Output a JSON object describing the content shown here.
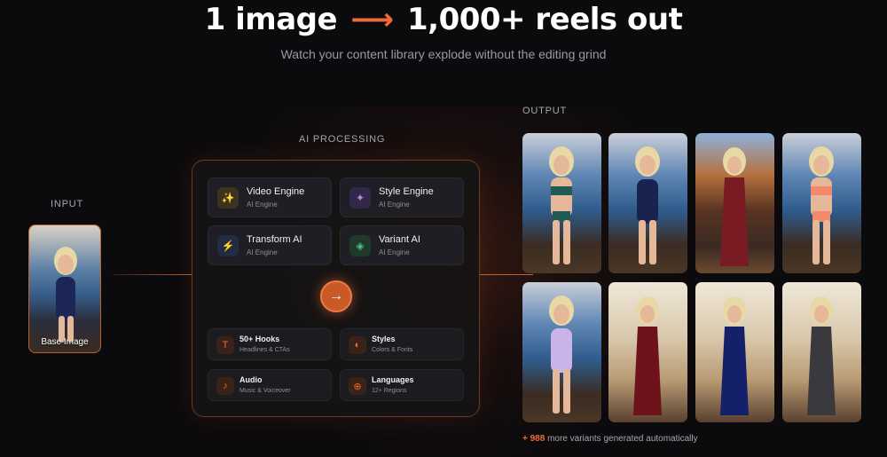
{
  "hero": {
    "title_left": "1 image",
    "arrow": "⟶",
    "title_right": "1,000+ reels out",
    "subtitle": "Watch your content library explode without the editing grind"
  },
  "input": {
    "label": "INPUT",
    "caption": "Base Image"
  },
  "processing": {
    "label": "AI PROCESSING",
    "engines": [
      {
        "name": "Video Engine",
        "sub": "AI Engine",
        "icon": "sparkles-icon",
        "glyph": "✨",
        "color": "#c9a23a"
      },
      {
        "name": "Style Engine",
        "sub": "AI Engine",
        "icon": "magic-wand-icon",
        "glyph": "✦",
        "color": "#b88ae8"
      },
      {
        "name": "Transform AI",
        "sub": "AI Engine",
        "icon": "lightning-icon",
        "glyph": "⚡",
        "color": "#5c8fe0"
      },
      {
        "name": "Variant AI",
        "sub": "AI Engine",
        "icon": "layers-icon",
        "glyph": "◈",
        "color": "#4fc07a"
      }
    ],
    "go_icon": "arrow-right-icon",
    "features": [
      {
        "name": "50+ Hooks",
        "sub": "Headlines & CTAs",
        "icon": "text-icon",
        "glyph": "T"
      },
      {
        "name": "Styles",
        "sub": "Colors & Fonts",
        "icon": "palette-icon",
        "glyph": "◐"
      },
      {
        "name": "Audio",
        "sub": "Music & Voiceover",
        "icon": "speaker-icon",
        "glyph": "♪"
      },
      {
        "name": "Languages",
        "sub": "12+ Regions",
        "icon": "globe-icon",
        "glyph": "⊕"
      }
    ]
  },
  "output": {
    "label": "OUTPUT",
    "more_count": "+ 988",
    "more_text": " more variants generated automatically"
  },
  "colors": {
    "accent": "#ee6a38",
    "background": "#0b0a0d"
  }
}
